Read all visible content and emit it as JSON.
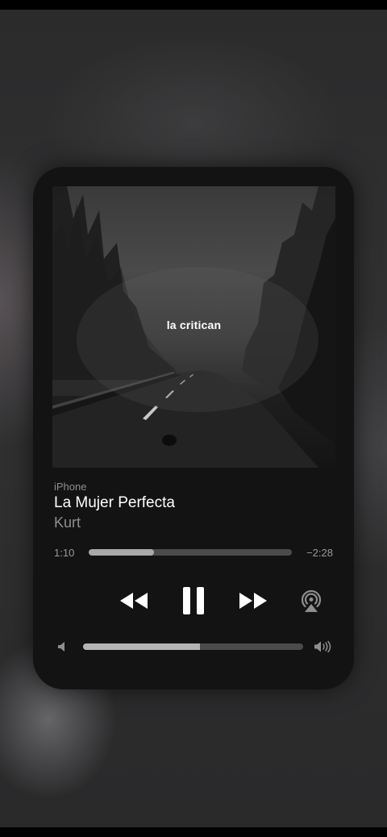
{
  "now_playing": {
    "lyric_overlay": "la critican",
    "device": "iPhone",
    "title": "La Mujer Perfecta",
    "artist": "Kurt",
    "elapsed": "1:10",
    "remaining": "−2:28",
    "progress_fraction": 0.32,
    "volume_fraction": 0.53
  },
  "controls": {
    "rewind_icon": "rewind-icon",
    "pause_icon": "pause-icon",
    "forward_icon": "fast-forward-icon",
    "airplay_icon": "airplay-icon",
    "volume_low_icon": "speaker-low-icon",
    "volume_high_icon": "speaker-high-icon"
  },
  "colors": {
    "card": "#131313",
    "text_primary": "#ffffff",
    "text_secondary": "#8e8e90",
    "track": "#4b4b4d",
    "track_fill": "#a9a9ab"
  }
}
